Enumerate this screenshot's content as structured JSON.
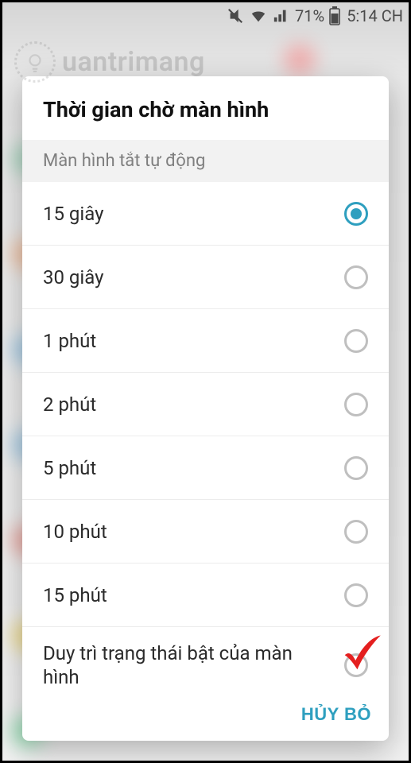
{
  "statusbar": {
    "battery_pct": "71%",
    "time": "5:14 CH"
  },
  "watermark": {
    "text": "uantrimang"
  },
  "dialog": {
    "title": "Thời gian chờ màn hình",
    "section_label": "Màn hình tắt tự động",
    "options": [
      {
        "label": "15 giây",
        "selected": true
      },
      {
        "label": "30 giây",
        "selected": false
      },
      {
        "label": "1 phút",
        "selected": false
      },
      {
        "label": "2 phút",
        "selected": false
      },
      {
        "label": "5 phút",
        "selected": false
      },
      {
        "label": "10 phút",
        "selected": false
      },
      {
        "label": "15 phút",
        "selected": false
      },
      {
        "label": "Duy trì trạng thái bật của màn hình",
        "selected": false
      }
    ],
    "cancel_label": "HỦY BỎ"
  },
  "annotation": {
    "highlight_option_index": 7
  }
}
